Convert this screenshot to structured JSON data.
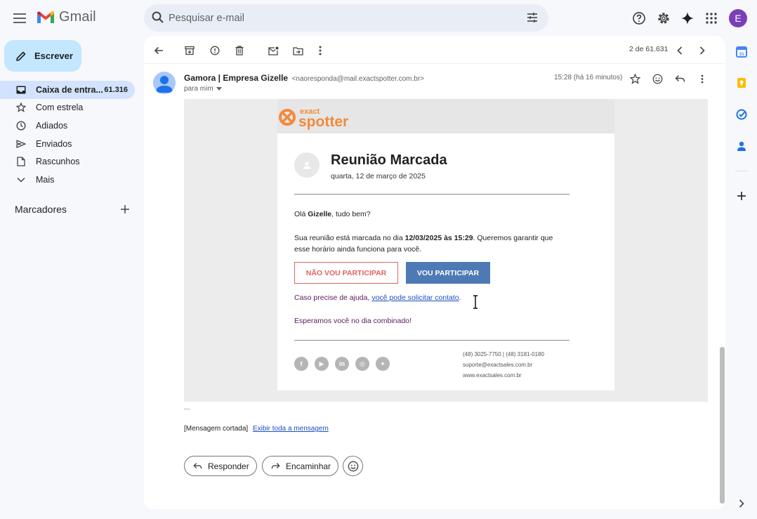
{
  "app": {
    "name": "Gmail"
  },
  "search": {
    "placeholder": "Pesquisar e-mail"
  },
  "compose": {
    "label": "Escrever"
  },
  "nav": [
    {
      "label": "Caixa de entra...",
      "count": "61.316",
      "icon": "inbox-icon",
      "active": true
    },
    {
      "label": "Com estrela",
      "icon": "star-icon"
    },
    {
      "label": "Adiados",
      "icon": "clock-icon"
    },
    {
      "label": "Enviados",
      "icon": "send-icon"
    },
    {
      "label": "Rascunhos",
      "icon": "draft-icon"
    },
    {
      "label": "Mais",
      "icon": "chevron-down-icon"
    }
  ],
  "labels": {
    "heading": "Marcadores"
  },
  "toolbar": {
    "page_count": "2 de 61.631"
  },
  "message": {
    "sender_name": "Gamora | Empresa Gizelle",
    "sender_email": "<naoresponda@mail.exactspotter.com.br>",
    "to": "para mim",
    "time": "15:28 (há 16 minutos)"
  },
  "email": {
    "brand_top": "exact",
    "brand_bottom": "spotter",
    "title": "Reunião Marcada",
    "date": "quarta, 12 de março de 2025",
    "greeting_pre": "Olá ",
    "greeting_name": "Gizelle",
    "greeting_post": ", tudo bem?",
    "body_pre": "Sua reunião está marcada no dia ",
    "body_bold": "12/03/2025 às 15:29",
    "body_post": ". Queremos garantir que esse horário ainda funciona para você.",
    "decline_label": "NÃO VOU PARTICIPAR",
    "accept_label": "VOU PARTICIPAR",
    "help_pre": "Caso precise de ajuda, ",
    "help_link": "você pode solicitar contato",
    "help_post": ".",
    "closing": "Esperamos você no dia combinado!",
    "phone": "(48) 3025-7750 | (48) 3181-0180",
    "support_email": "suporte@exactsales.com.br",
    "website": "www.exactsales.com.br"
  },
  "footer": {
    "ellipsis": "...",
    "truncated": "[Mensagem cortada]",
    "view_all": "Exibir toda a mensagem",
    "reply": "Responder",
    "forward": "Encaminhar"
  },
  "user": {
    "initial": "E"
  },
  "colors": {
    "compose_bg": "#c2e7ff",
    "active_nav": "#d3e3fd",
    "accept_btn": "#4d79b5",
    "decline_btn": "#e36262",
    "brand_orange": "#f28a3c"
  }
}
